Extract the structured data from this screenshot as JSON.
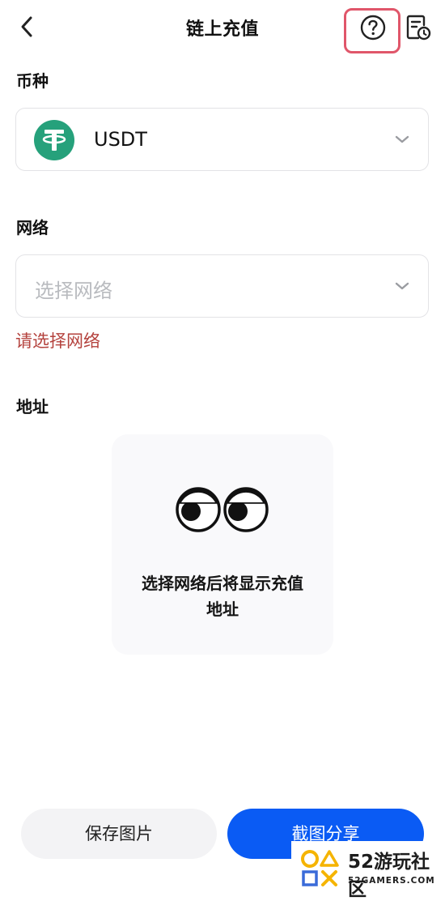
{
  "header": {
    "title": "链上充值",
    "back_icon": "chevron-left-icon",
    "help_icon": "question-circle-icon",
    "history_icon": "record-history-icon",
    "highlight_color": "#e0566a"
  },
  "currency": {
    "label": "币种",
    "selected": "USDT",
    "icon": "tether-icon",
    "icon_color": "#26a17b"
  },
  "network": {
    "label": "网络",
    "placeholder": "选择网络",
    "error": "请选择网络"
  },
  "address": {
    "label": "地址",
    "empty_message_line1": "选择网络后将显示充值",
    "empty_message_line2": "地址",
    "illustration": "eyes-icon"
  },
  "actions": {
    "save_label": "保存图片",
    "share_label": "截图分享",
    "share_color": "#0a5bf4"
  },
  "watermark": {
    "title": "52游玩社区",
    "subtitle": "52GAMERS.COM"
  }
}
